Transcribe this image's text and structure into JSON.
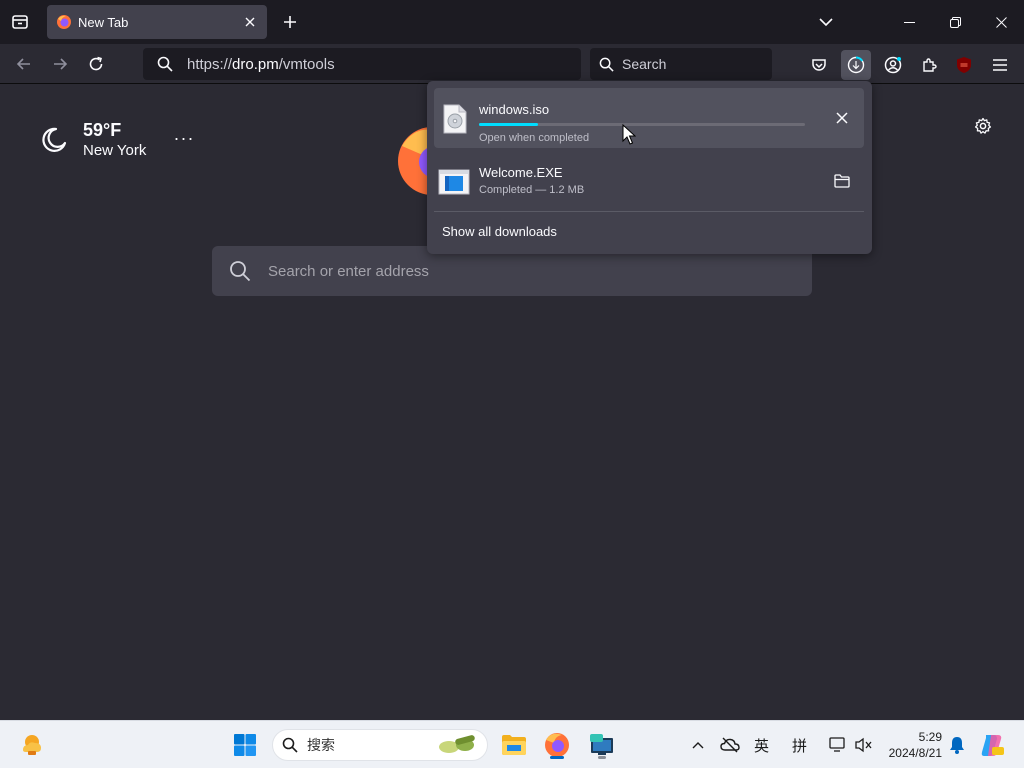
{
  "tab": {
    "title": "New Tab"
  },
  "urlbar": {
    "scheme": "https://",
    "host": "dro.pm",
    "path": "/vmtools"
  },
  "searchbar": {
    "placeholder": "Search"
  },
  "weather": {
    "temperature": "59°F",
    "city": "New York",
    "menu": "···"
  },
  "newtab_search": {
    "placeholder": "Search or enter address"
  },
  "downloads": {
    "items": [
      {
        "name": "windows.iso",
        "status": "Open when completed",
        "progress": 0.18,
        "icon": "disc-file-icon",
        "action": "cancel"
      },
      {
        "name": "Welcome.EXE",
        "status": "Completed — 1.2 MB",
        "icon": "exe-file-icon",
        "action": "show-in-folder"
      }
    ],
    "show_all": "Show all downloads"
  },
  "taskbar": {
    "search_placeholder": "搜索",
    "ime_lang": "英",
    "ime_mode": "拼",
    "time": "5:29",
    "date": "2024/8/21"
  },
  "colors": {
    "accent": "#00ddff",
    "chrome_dark": "#1c1b22",
    "content_bg": "#2b2a33",
    "panel_bg": "#42414d",
    "taskbar_bg": "#eef1f6"
  }
}
